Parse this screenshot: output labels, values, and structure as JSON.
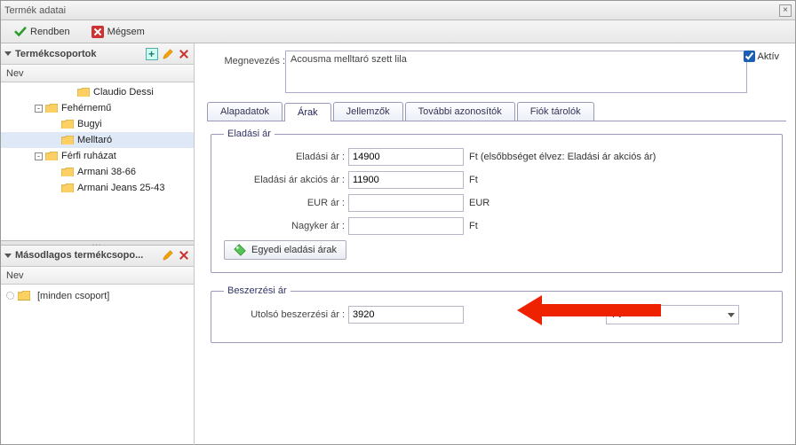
{
  "window": {
    "title": "Termék adatai"
  },
  "toolbar": {
    "ok": "Rendben",
    "cancel": "Mégsem"
  },
  "left": {
    "panel1_title": "Termékcsoportok",
    "panel2_title": "Másodlagos termékcsopo...",
    "col_header": "Nev",
    "tree": [
      {
        "indent": 74,
        "toggle": "",
        "label": "Claudio Dessi"
      },
      {
        "indent": 38,
        "toggle": "-",
        "label": "Fehérnemű"
      },
      {
        "indent": 56,
        "toggle": "",
        "label": "Bugyi"
      },
      {
        "indent": 56,
        "toggle": "",
        "label": "Melltaró",
        "selected": true
      },
      {
        "indent": 38,
        "toggle": "-",
        "label": "Férfi ruházat"
      },
      {
        "indent": 56,
        "toggle": "",
        "label": "Armani 38-66"
      },
      {
        "indent": 56,
        "toggle": "",
        "label": "Armani Jeans 25-43"
      }
    ],
    "tree2_label": "[minden csoport]"
  },
  "right": {
    "name_label": "Megnevezés :",
    "name_value": "Acousma melltaró szett lila",
    "active_label": "Aktív",
    "active_checked": true,
    "tabs": {
      "t0": "Alapadatok",
      "t1": "Árak",
      "t2": "Jellemzők",
      "t3": "További azonosítók",
      "t4": "Fiók tárolók"
    },
    "sell": {
      "legend": "Eladási ár",
      "price_label": "Eladási ár :",
      "price_value": "14900",
      "price_suffix": "Ft (elsőbbséget élvez: Eladási ár akciós ár)",
      "sale_label": "Eladási ár akciós ár :",
      "sale_value": "11900",
      "sale_suffix": "Ft",
      "eur_label": "EUR ár :",
      "eur_value": "",
      "eur_suffix": "EUR",
      "whole_label": "Nagyker ár :",
      "whole_value": "",
      "whole_suffix": "Ft",
      "custom_btn": "Egyedi eladási árak"
    },
    "purchase": {
      "legend": "Beszerzési ár",
      "last_label": "Utolsó beszerzési ár :",
      "last_value": "3920",
      "currency": "Ft"
    }
  }
}
